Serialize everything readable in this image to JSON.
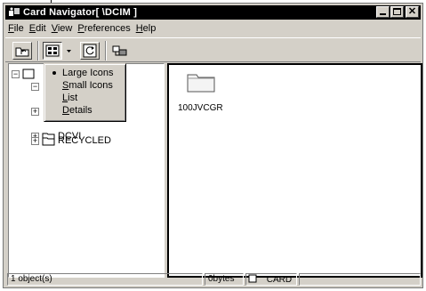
{
  "window": {
    "title": "Card Navigator[ \\DCIM ]"
  },
  "menu": [
    {
      "label": "File",
      "underline": "F",
      "rest": "ile"
    },
    {
      "label": "Edit",
      "underline": "E",
      "rest": "dit"
    },
    {
      "label": "View",
      "underline": "V",
      "rest": "iew"
    },
    {
      "label": "Preferences",
      "underline": "P",
      "rest": "references"
    },
    {
      "label": "Help",
      "underline": "H",
      "rest": "elp"
    }
  ],
  "toolbar": {
    "buttons": [
      "up-folder",
      "view-mode",
      "view-dropdown",
      "refresh",
      "connect"
    ]
  },
  "view_menu": {
    "items": [
      {
        "label": "Large Icons",
        "underline": "",
        "rest": "Large Icons",
        "checked": true
      },
      {
        "label": "Small Icons",
        "underline": "S",
        "rest": "mall Icons",
        "checked": false
      },
      {
        "label": "List",
        "underline": "L",
        "rest": "ist",
        "checked": false
      },
      {
        "label": "Details",
        "underline": "D",
        "rest": "etails",
        "checked": false
      }
    ]
  },
  "tree": {
    "items": [
      {
        "label": "DCVI"
      },
      {
        "label": "RECYCLED"
      }
    ]
  },
  "list": {
    "items": [
      {
        "label": "100JVCGR"
      }
    ]
  },
  "status": {
    "objects": "1 object(s)",
    "size": "0bytes",
    "drive": "CARD"
  }
}
